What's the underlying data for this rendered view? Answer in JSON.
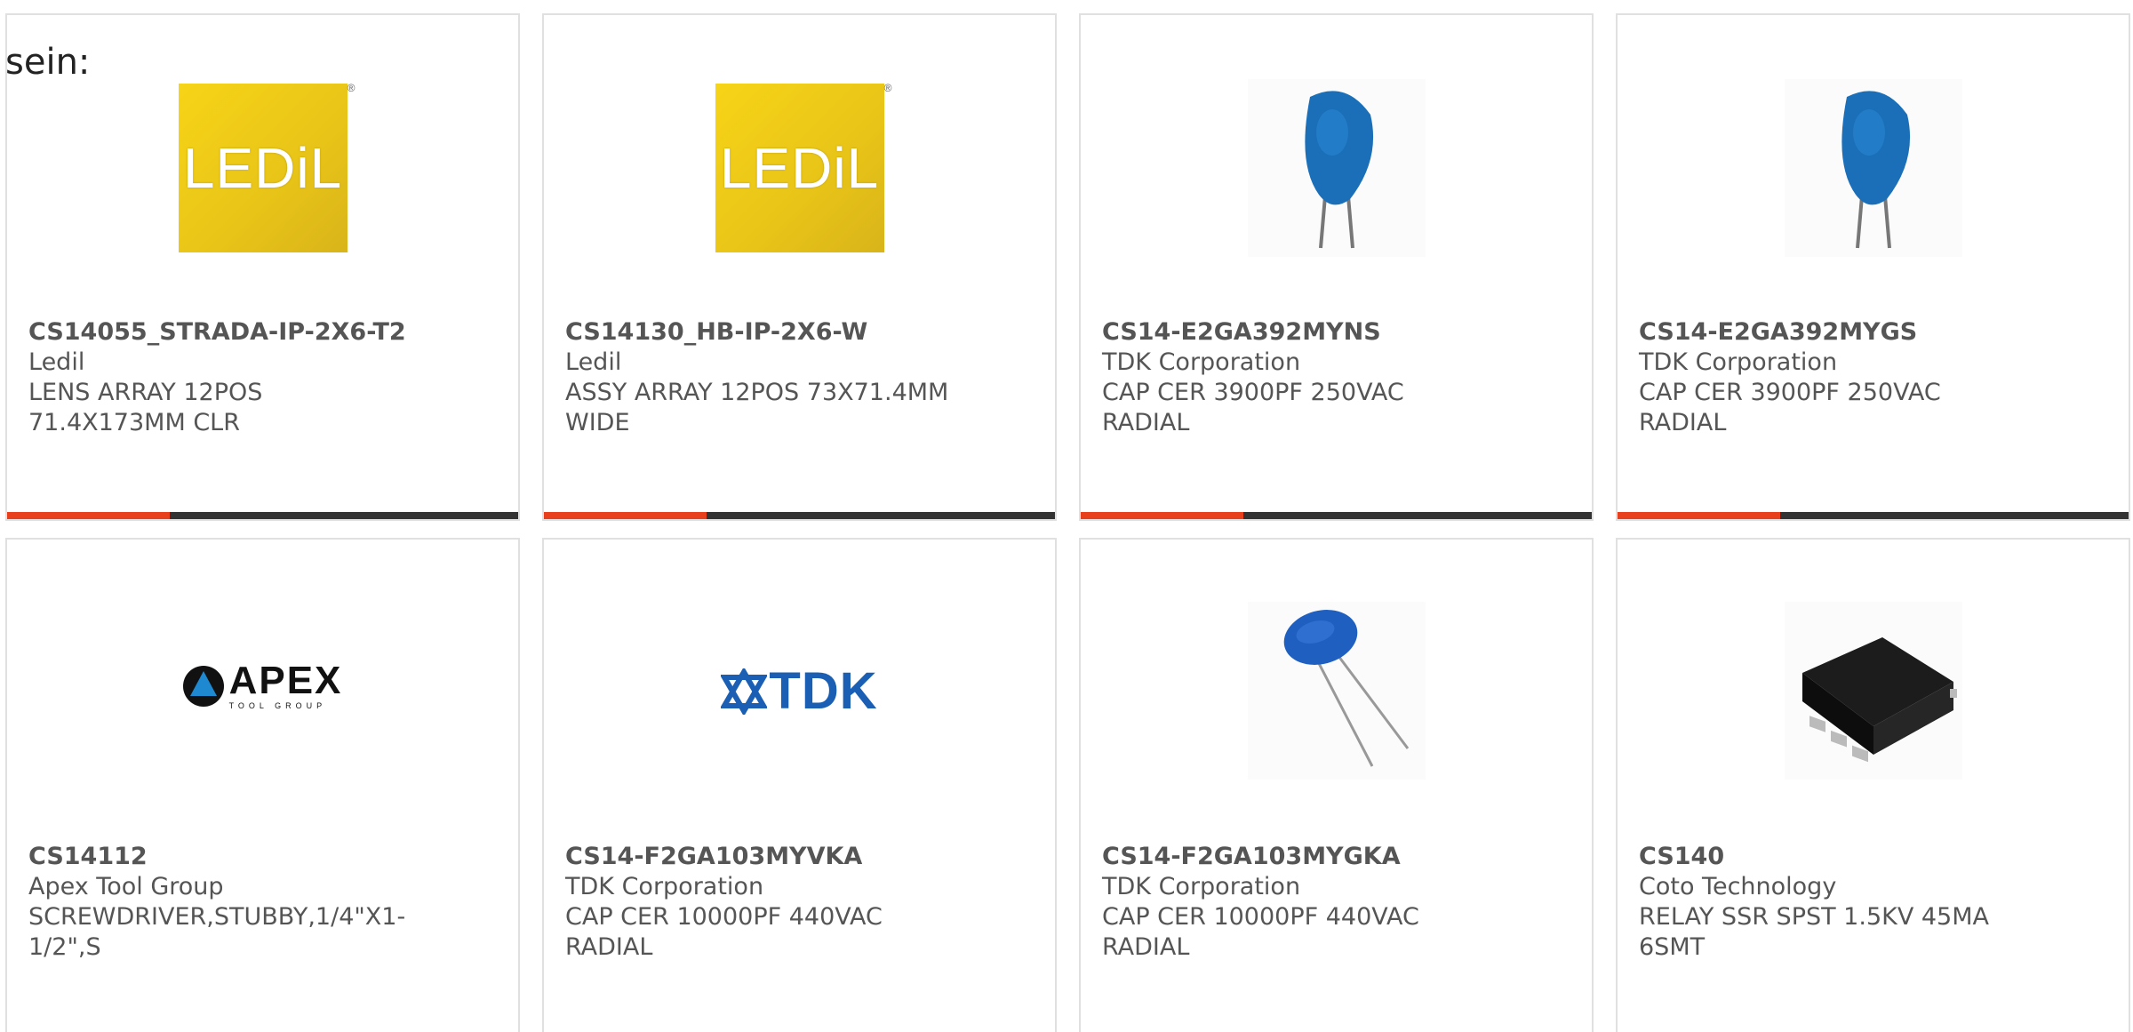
{
  "intro_text": "sein:",
  "colors": {
    "accent": "#e8401c",
    "bar": "#333333",
    "border": "#e0e0e0",
    "text": "#555555"
  },
  "products": [
    {
      "part": "CS14055_STRADA-IP-2X6-T2",
      "manufacturer": "Ledil",
      "description": "LENS ARRAY 12POS 71.4X173MM CLR",
      "image": "ledil-logo",
      "logo_text": "LEDiL"
    },
    {
      "part": "CS14130_HB-IP-2X6-W",
      "manufacturer": "Ledil",
      "description": "ASSY ARRAY 12POS 73X71.4MM WIDE",
      "image": "ledil-logo",
      "logo_text": "LEDiL"
    },
    {
      "part": "CS14-E2GA392MYNS",
      "manufacturer": "TDK Corporation",
      "description": "CAP CER 3900PF 250VAC RADIAL",
      "image": "ceramic-capacitor-photo"
    },
    {
      "part": "CS14-E2GA392MYGS",
      "manufacturer": "TDK Corporation",
      "description": "CAP CER 3900PF 250VAC RADIAL",
      "image": "ceramic-capacitor-photo"
    },
    {
      "part": "CS14112",
      "manufacturer": "Apex Tool Group",
      "description": "SCREWDRIVER,STUBBY,1/4\"X1-1/2\",S",
      "image": "apex-logo",
      "logo_text": "APEX",
      "logo_subtext": "TOOL GROUP"
    },
    {
      "part": "CS14-F2GA103MYVKA",
      "manufacturer": "TDK Corporation",
      "description": "CAP CER 10000PF 440VAC RADIAL",
      "image": "tdk-logo",
      "logo_text": "TDK"
    },
    {
      "part": "CS14-F2GA103MYGKA",
      "manufacturer": "TDK Corporation",
      "description": "CAP CER 10000PF 440VAC RADIAL",
      "image": "disc-capacitor-photo"
    },
    {
      "part": "CS140",
      "manufacturer": "Coto Technology",
      "description": "RELAY SSR SPST 1.5KV 45MA 6SMT",
      "image": "smt-relay-photo"
    }
  ]
}
